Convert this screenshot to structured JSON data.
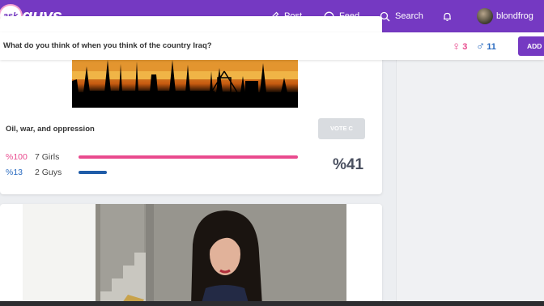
{
  "header": {
    "logo_ask": "ask",
    "logo_guys": "guys",
    "nav": {
      "post": "Post",
      "feed": "Feed",
      "search": "Search",
      "username": "blondfrog"
    }
  },
  "question": {
    "title": "What do you think of when you think of the country Iraq?",
    "girls_count": "3",
    "guys_count": "11",
    "girl_symbol": "♀",
    "guy_symbol": "♂",
    "add_label": "ADD"
  },
  "poll": {
    "option_text": "Oil, war, and oppression",
    "vote_label": "VOTE C",
    "girls_pct": "%100",
    "girls_count": "7 Girls",
    "girls_fraction": 1.0,
    "guys_pct": "%13",
    "guys_count": "2 Guys",
    "guys_fraction": 0.13,
    "overall_pct": "%41"
  },
  "colors": {
    "brand": "#7539c2",
    "girls": "#e94a8e",
    "guys": "#2a6bc0"
  },
  "icons": [
    "pencil-icon",
    "circle-icon",
    "search-icon",
    "bell-icon"
  ]
}
